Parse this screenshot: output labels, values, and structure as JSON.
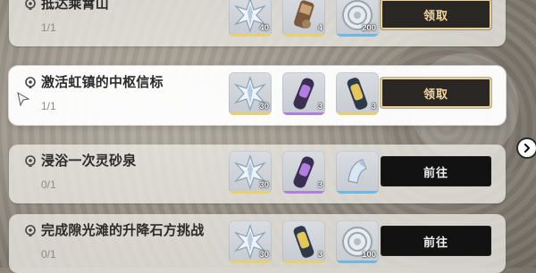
{
  "quests": [
    {
      "title": "抵达乘霄山",
      "progress": "1/1",
      "button_label": "领取",
      "button_type": "claim",
      "rewards": [
        {
          "icon": "star-crystal-icon",
          "qty": "40",
          "rarity_color": "#e8d06b"
        },
        {
          "icon": "bundle-item-icon",
          "qty": "4",
          "rarity_color": "#e8d06b"
        },
        {
          "icon": "credit-coin-icon",
          "qty": "200",
          "rarity_color": "#6fb6e8"
        }
      ]
    },
    {
      "title": "激活虹镇的中枢信标",
      "progress": "1/1",
      "button_label": "领取",
      "button_type": "claim",
      "rewards": [
        {
          "icon": "star-crystal-icon",
          "qty": "30",
          "rarity_color": "#e8d06b"
        },
        {
          "icon": "capsule-purple-icon",
          "qty": "3",
          "rarity_color": "#b37de0"
        },
        {
          "icon": "canister-gold-icon",
          "qty": "3",
          "rarity_color": "#e8d06b"
        }
      ]
    },
    {
      "title": "浸浴一次灵砂泉",
      "progress": "0/1",
      "button_label": "前往",
      "button_type": "go",
      "rewards": [
        {
          "icon": "star-crystal-icon",
          "qty": "30",
          "rarity_color": "#e8d06b"
        },
        {
          "icon": "capsule-purple-icon",
          "qty": "3",
          "rarity_color": "#b37de0"
        },
        {
          "icon": "crystal-shard-icon",
          "qty": "",
          "rarity_color": "#6fb6e8"
        }
      ]
    },
    {
      "title": "完成隙光滩的升降石方挑战",
      "progress": "0/1",
      "button_label": "前往",
      "button_type": "go",
      "rewards": [
        {
          "icon": "star-crystal-icon",
          "qty": "30",
          "rarity_color": "#e8d06b"
        },
        {
          "icon": "canister-gold-icon",
          "qty": "3",
          "rarity_color": "#e8d06b"
        },
        {
          "icon": "credit-coin-icon",
          "qty": "100",
          "rarity_color": "#6fb6e8"
        }
      ]
    }
  ],
  "side_arrow_icon": "chevron-right-icon",
  "cursor_icon": "pointer-cursor-icon"
}
